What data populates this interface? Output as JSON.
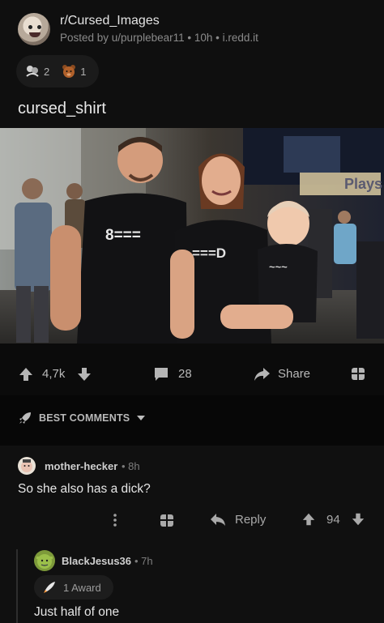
{
  "post": {
    "subreddit": "r/Cursed_Images",
    "meta": "Posted by u/purplebear11 • 10h • i.redd.it",
    "awards": [
      {
        "icon": "hugz-award-icon",
        "count": "2"
      },
      {
        "icon": "bear-award-icon",
        "count": "1"
      }
    ],
    "title": "cursed_shirt",
    "image": {
      "shirt_left_text": "8===",
      "shirt_mid_text": "===D",
      "shirt_baby_text": "~~~",
      "background_sign": "Plays"
    }
  },
  "actions": {
    "upvotes": "4,7k",
    "comments": "28",
    "share": "Share"
  },
  "sort": {
    "label": "BEST COMMENTS"
  },
  "comments": [
    {
      "user": "mother-hecker",
      "time": "• 8h",
      "body": "So she also has a dick?",
      "reply_label": "Reply",
      "score": "94"
    },
    {
      "user": "BlackJesus36",
      "time": "• 7h",
      "award_label": "1 Award",
      "body": "Just half of one"
    }
  ],
  "colors": {
    "background": "#0b0b0b",
    "text": "#d7dadc",
    "muted": "#8a8a8a"
  }
}
